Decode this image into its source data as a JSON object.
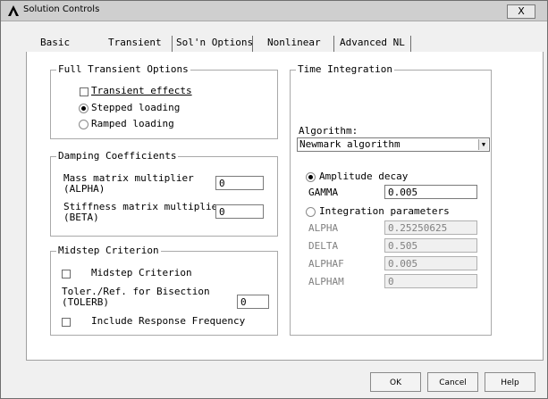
{
  "window": {
    "title": "Solution Controls",
    "close_label": "X"
  },
  "tabs": [
    "Basic",
    "Transient",
    "Sol'n Options",
    "Nonlinear",
    "Advanced NL"
  ],
  "full_transient": {
    "title": "Full Transient Options",
    "transient_effects": {
      "label": "Transient effects",
      "checked": false
    },
    "stepped": {
      "label": "Stepped loading",
      "selected": true
    },
    "ramped": {
      "label": "Ramped loading",
      "selected": false
    }
  },
  "damping": {
    "title": "Damping Coefficients",
    "mass_label": "Mass matrix multiplier\n(ALPHA)",
    "mass_value": "0",
    "stiff_label": "Stiffness matrix multiplier\n(BETA)",
    "stiff_value": "0"
  },
  "midstep": {
    "title": "Midstep Criterion",
    "midstep_label": "Midstep Criterion",
    "toler_label": "Toler./Ref. for Bisection\n(TOLERB)",
    "toler_value": "0",
    "include_label": "Include Response Frequency"
  },
  "time_integration": {
    "title": "Time Integration",
    "algorithm_label": "Algorithm:",
    "algorithm_value": "Newmark algorithm",
    "amplitude_decay": {
      "label": "Amplitude decay",
      "selected": true
    },
    "gamma_label": "GAMMA",
    "gamma_value": "0.005",
    "integration_params": {
      "label": "Integration parameters",
      "selected": false
    },
    "alpha_label": "ALPHA",
    "alpha_value": "0.25250625",
    "delta_label": "DELTA",
    "delta_value": "0.505",
    "alphaf_label": "ALPHAF",
    "alphaf_value": "0.005",
    "alpham_label": "ALPHAM",
    "alpham_value": "0"
  },
  "buttons": {
    "ok": "OK",
    "cancel": "Cancel",
    "help": "Help"
  }
}
